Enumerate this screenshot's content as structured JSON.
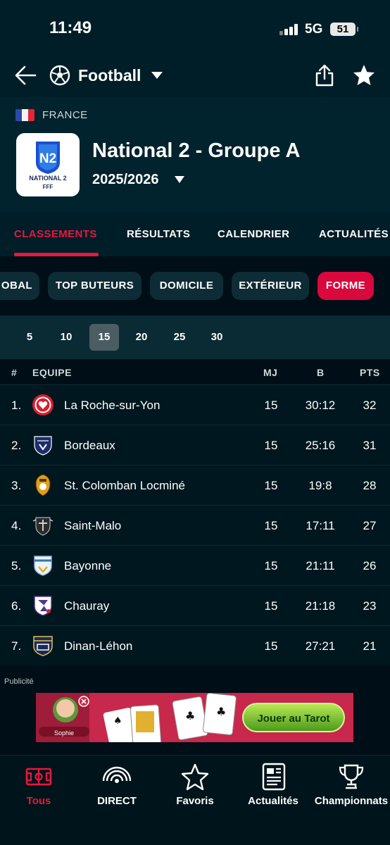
{
  "status_bar": {
    "time": "11:49",
    "network": "5G",
    "battery": "51"
  },
  "nav": {
    "sport": "Football"
  },
  "league": {
    "country": "FRANCE",
    "name": "National 2 - Groupe A",
    "season": "2025/2026",
    "logo_badge": "N2",
    "logo_line1": "NATIONAL 2",
    "logo_line2": "FFF"
  },
  "tabs": [
    {
      "label": "CLASSEMENTS",
      "active": true
    },
    {
      "label": "RÉSULTATS",
      "active": false
    },
    {
      "label": "CALENDRIER",
      "active": false
    },
    {
      "label": "ACTUALITÉS",
      "active": false
    }
  ],
  "filters": [
    {
      "label": "OBAL",
      "active": false
    },
    {
      "label": "TOP BUTEURS",
      "active": false
    },
    {
      "label": "DOMICILE",
      "active": false
    },
    {
      "label": "EXTÉRIEUR",
      "active": false
    },
    {
      "label": "FORME",
      "active": true
    }
  ],
  "form_options": [
    {
      "label": "5",
      "active": false
    },
    {
      "label": "10",
      "active": false
    },
    {
      "label": "15",
      "active": true
    },
    {
      "label": "20",
      "active": false
    },
    {
      "label": "25",
      "active": false
    },
    {
      "label": "30",
      "active": false
    }
  ],
  "table": {
    "headers": {
      "rank": "#",
      "team": "EQUIPE",
      "played": "MJ",
      "goals": "B",
      "points": "PTS"
    },
    "rows": [
      {
        "rank": "1.",
        "team": "La Roche-sur-Yon",
        "played": "15",
        "goals": "30:12",
        "points": "32",
        "crest_color": "#d5202f"
      },
      {
        "rank": "2.",
        "team": "Bordeaux",
        "played": "15",
        "goals": "25:16",
        "points": "31",
        "crest_color": "#1c2d6b"
      },
      {
        "rank": "3.",
        "team": "St. Colomban Locminé",
        "played": "15",
        "goals": "19:8",
        "points": "28",
        "crest_color": "#e0a01b"
      },
      {
        "rank": "4.",
        "team": "Saint-Malo",
        "played": "15",
        "goals": "17:11",
        "points": "27",
        "crest_color": "#2b2b2b"
      },
      {
        "rank": "5.",
        "team": "Bayonne",
        "played": "15",
        "goals": "21:11",
        "points": "26",
        "crest_color": "#8fb7e0"
      },
      {
        "rank": "6.",
        "team": "Chauray",
        "played": "15",
        "goals": "21:18",
        "points": "23",
        "crest_color": "#4b3a8c"
      },
      {
        "rank": "7.",
        "team": "Dinan-Léhon",
        "played": "15",
        "goals": "27:21",
        "points": "21",
        "crest_color": "#1b2a55"
      }
    ]
  },
  "ad": {
    "label": "Publicité",
    "cta": "Jouer au Tarot",
    "player_name": "Sophie"
  },
  "bottom_nav": [
    {
      "label": "Tous",
      "icon": "pitch-icon",
      "active": true
    },
    {
      "label": "DIRECT",
      "icon": "live-icon",
      "active": false
    },
    {
      "label": "Favoris",
      "icon": "star-icon",
      "active": false
    },
    {
      "label": "Actualités",
      "icon": "news-icon",
      "active": false
    },
    {
      "label": "Championnats",
      "icon": "trophy-icon",
      "active": false
    }
  ],
  "colors": {
    "accent": "#e8173f",
    "background": "#000f17",
    "header": "#00232d"
  }
}
